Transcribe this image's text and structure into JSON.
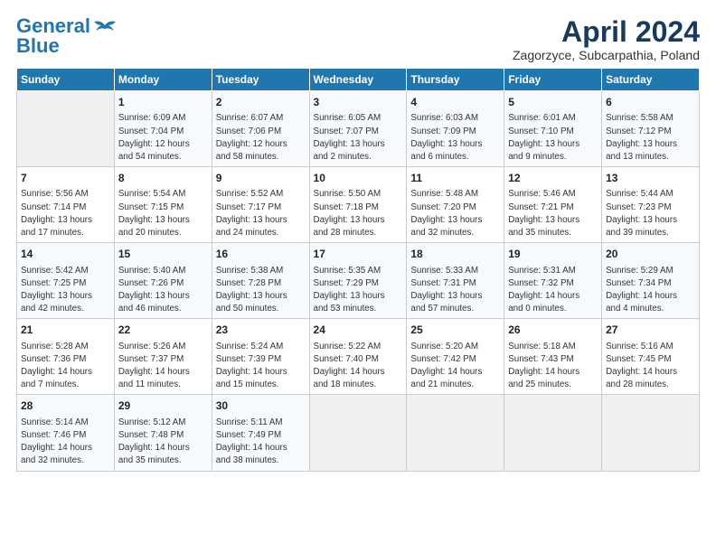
{
  "header": {
    "logo_line1": "General",
    "logo_line2": "Blue",
    "month_year": "April 2024",
    "location": "Zagorzyce, Subcarpathia, Poland"
  },
  "weekdays": [
    "Sunday",
    "Monday",
    "Tuesday",
    "Wednesday",
    "Thursday",
    "Friday",
    "Saturday"
  ],
  "weeks": [
    [
      {
        "day": "",
        "info": ""
      },
      {
        "day": "1",
        "info": "Sunrise: 6:09 AM\nSunset: 7:04 PM\nDaylight: 12 hours\nand 54 minutes."
      },
      {
        "day": "2",
        "info": "Sunrise: 6:07 AM\nSunset: 7:06 PM\nDaylight: 12 hours\nand 58 minutes."
      },
      {
        "day": "3",
        "info": "Sunrise: 6:05 AM\nSunset: 7:07 PM\nDaylight: 13 hours\nand 2 minutes."
      },
      {
        "day": "4",
        "info": "Sunrise: 6:03 AM\nSunset: 7:09 PM\nDaylight: 13 hours\nand 6 minutes."
      },
      {
        "day": "5",
        "info": "Sunrise: 6:01 AM\nSunset: 7:10 PM\nDaylight: 13 hours\nand 9 minutes."
      },
      {
        "day": "6",
        "info": "Sunrise: 5:58 AM\nSunset: 7:12 PM\nDaylight: 13 hours\nand 13 minutes."
      }
    ],
    [
      {
        "day": "7",
        "info": "Sunrise: 5:56 AM\nSunset: 7:14 PM\nDaylight: 13 hours\nand 17 minutes."
      },
      {
        "day": "8",
        "info": "Sunrise: 5:54 AM\nSunset: 7:15 PM\nDaylight: 13 hours\nand 20 minutes."
      },
      {
        "day": "9",
        "info": "Sunrise: 5:52 AM\nSunset: 7:17 PM\nDaylight: 13 hours\nand 24 minutes."
      },
      {
        "day": "10",
        "info": "Sunrise: 5:50 AM\nSunset: 7:18 PM\nDaylight: 13 hours\nand 28 minutes."
      },
      {
        "day": "11",
        "info": "Sunrise: 5:48 AM\nSunset: 7:20 PM\nDaylight: 13 hours\nand 32 minutes."
      },
      {
        "day": "12",
        "info": "Sunrise: 5:46 AM\nSunset: 7:21 PM\nDaylight: 13 hours\nand 35 minutes."
      },
      {
        "day": "13",
        "info": "Sunrise: 5:44 AM\nSunset: 7:23 PM\nDaylight: 13 hours\nand 39 minutes."
      }
    ],
    [
      {
        "day": "14",
        "info": "Sunrise: 5:42 AM\nSunset: 7:25 PM\nDaylight: 13 hours\nand 42 minutes."
      },
      {
        "day": "15",
        "info": "Sunrise: 5:40 AM\nSunset: 7:26 PM\nDaylight: 13 hours\nand 46 minutes."
      },
      {
        "day": "16",
        "info": "Sunrise: 5:38 AM\nSunset: 7:28 PM\nDaylight: 13 hours\nand 50 minutes."
      },
      {
        "day": "17",
        "info": "Sunrise: 5:35 AM\nSunset: 7:29 PM\nDaylight: 13 hours\nand 53 minutes."
      },
      {
        "day": "18",
        "info": "Sunrise: 5:33 AM\nSunset: 7:31 PM\nDaylight: 13 hours\nand 57 minutes."
      },
      {
        "day": "19",
        "info": "Sunrise: 5:31 AM\nSunset: 7:32 PM\nDaylight: 14 hours\nand 0 minutes."
      },
      {
        "day": "20",
        "info": "Sunrise: 5:29 AM\nSunset: 7:34 PM\nDaylight: 14 hours\nand 4 minutes."
      }
    ],
    [
      {
        "day": "21",
        "info": "Sunrise: 5:28 AM\nSunset: 7:36 PM\nDaylight: 14 hours\nand 7 minutes."
      },
      {
        "day": "22",
        "info": "Sunrise: 5:26 AM\nSunset: 7:37 PM\nDaylight: 14 hours\nand 11 minutes."
      },
      {
        "day": "23",
        "info": "Sunrise: 5:24 AM\nSunset: 7:39 PM\nDaylight: 14 hours\nand 15 minutes."
      },
      {
        "day": "24",
        "info": "Sunrise: 5:22 AM\nSunset: 7:40 PM\nDaylight: 14 hours\nand 18 minutes."
      },
      {
        "day": "25",
        "info": "Sunrise: 5:20 AM\nSunset: 7:42 PM\nDaylight: 14 hours\nand 21 minutes."
      },
      {
        "day": "26",
        "info": "Sunrise: 5:18 AM\nSunset: 7:43 PM\nDaylight: 14 hours\nand 25 minutes."
      },
      {
        "day": "27",
        "info": "Sunrise: 5:16 AM\nSunset: 7:45 PM\nDaylight: 14 hours\nand 28 minutes."
      }
    ],
    [
      {
        "day": "28",
        "info": "Sunrise: 5:14 AM\nSunset: 7:46 PM\nDaylight: 14 hours\nand 32 minutes."
      },
      {
        "day": "29",
        "info": "Sunrise: 5:12 AM\nSunset: 7:48 PM\nDaylight: 14 hours\nand 35 minutes."
      },
      {
        "day": "30",
        "info": "Sunrise: 5:11 AM\nSunset: 7:49 PM\nDaylight: 14 hours\nand 38 minutes."
      },
      {
        "day": "",
        "info": ""
      },
      {
        "day": "",
        "info": ""
      },
      {
        "day": "",
        "info": ""
      },
      {
        "day": "",
        "info": ""
      }
    ]
  ]
}
